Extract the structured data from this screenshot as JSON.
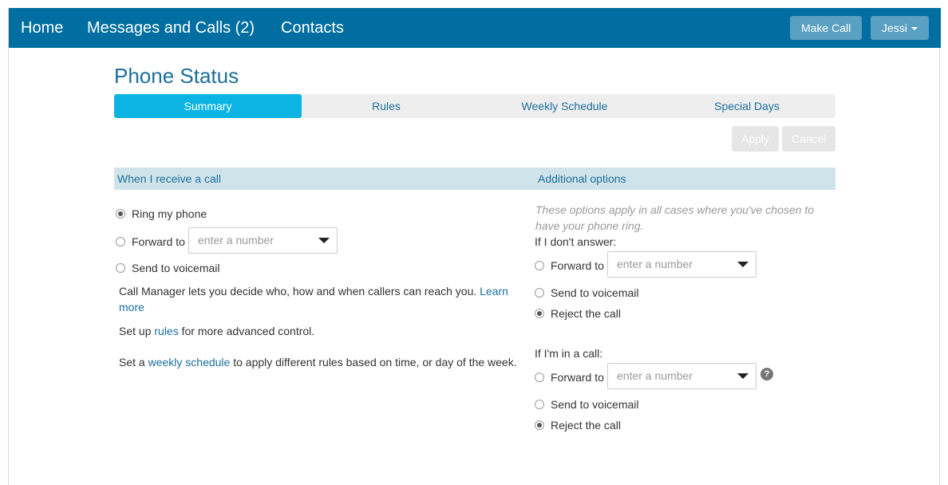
{
  "nav": {
    "home": "Home",
    "messages": "Messages and Calls (2)",
    "contacts": "Contacts",
    "make_call": "Make Call",
    "user": "Jessi"
  },
  "page": {
    "title": "Phone Status"
  },
  "tabs": [
    {
      "label": "Summary",
      "active": true
    },
    {
      "label": "Rules",
      "active": false
    },
    {
      "label": "Weekly Schedule",
      "active": false
    },
    {
      "label": "Special Days",
      "active": false
    }
  ],
  "actions": {
    "apply": "Apply",
    "cancel": "Cancel"
  },
  "left": {
    "header": "When I receive a call",
    "options": [
      {
        "label": "Ring my phone",
        "checked": true
      },
      {
        "label": "Forward to",
        "checked": false
      },
      {
        "label": "Send to voicemail",
        "checked": false
      }
    ],
    "forward_placeholder": "enter a number",
    "info1_text": "Call Manager lets you decide who, how and when callers can reach you.",
    "info1_link_a": "Learn",
    "info1_link_b": "more",
    "info2_pre": "Set up",
    "info2_link": "rules",
    "info2_post": "for more advanced control.",
    "info3_pre": "Set a",
    "info3_link": "weekly schedule",
    "info3_post": "to apply different rules based on time, or day of the week."
  },
  "right": {
    "header": "Additional options",
    "note_line1": "These options apply in all cases where you've chosen to",
    "note_line2": "have your phone ring.",
    "no_answer": {
      "title": "If I don't answer:",
      "forward": "Forward to",
      "placeholder": "enter a number",
      "voicemail": "Send to voicemail",
      "reject": "Reject the call",
      "selected": "reject"
    },
    "in_call": {
      "title": "If I'm in a call:",
      "forward": "Forward to",
      "placeholder": "enter a number",
      "voicemail": "Send to voicemail",
      "reject": "Reject the call",
      "selected": "reject",
      "help": "?"
    }
  },
  "colors": {
    "navbar": "#006ea0",
    "tab_active": "#0bb4e2",
    "section_bar": "#cfe3ea",
    "link": "#1c6f9c"
  }
}
